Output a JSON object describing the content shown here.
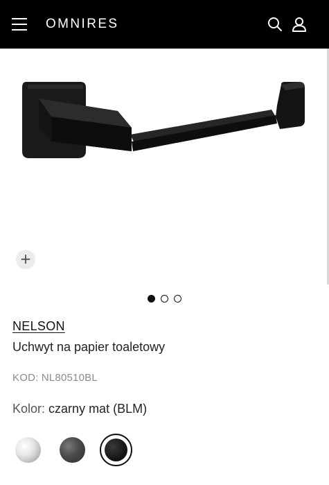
{
  "header": {
    "brand": "OMNIRES",
    "menu_icon": "hamburger-menu-icon",
    "search_icon": "search-icon",
    "account_icon": "user-icon",
    "background": "#000000"
  },
  "gallery": {
    "zoom_icon": "plus-icon",
    "zoom_label": "+",
    "slide_count": 3,
    "active_slide": 1
  },
  "product": {
    "series": "NELSON",
    "name": "Uchwyt na papier toaletowy",
    "code": "KOD: NL80510BL",
    "color_label": "Kolor:",
    "color_value": "czarny mat (BLM)"
  },
  "swatches": [
    {
      "name": "chrome",
      "color": "#d9d9d9"
    },
    {
      "name": "graphite",
      "color": "#4a4a4a"
    },
    {
      "name": "black-matte",
      "color": "#111111",
      "selected": true
    }
  ]
}
